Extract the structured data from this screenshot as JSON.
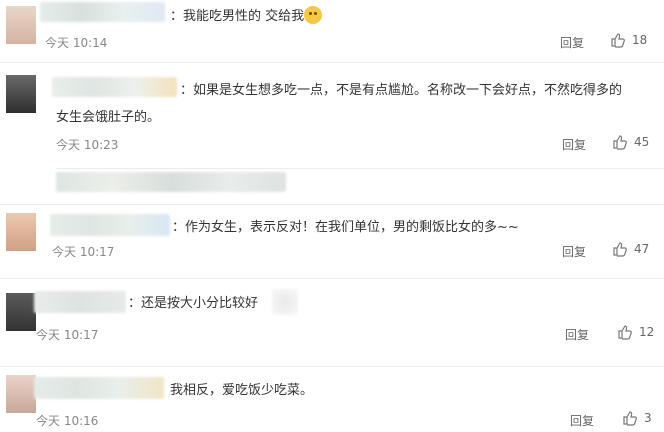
{
  "comments": [
    {
      "text": "：我能吃男性的 交给我",
      "emoji": "grin-face-icon",
      "time": "今天 10:14",
      "reply": "回复",
      "likes": "18"
    },
    {
      "text_line1": "：如果是女生想多吃一点，不是有点尴尬。名称改一下会好点，不然吃得多的",
      "text_line2": "女生会饿肚子的。",
      "time": "今天 10:23",
      "reply": "回复",
      "likes": "45"
    },
    {
      "text": "：作为女生，表示反对！在我们单位，男的剩饭比女的多~~",
      "time": "今天 10:17",
      "reply": "回复",
      "likes": "47"
    },
    {
      "text": "：还是按大小分比较好",
      "time": "今天 10:17",
      "reply": "回复",
      "likes": "12"
    },
    {
      "text": "我相反，爱吃饭少吃菜。",
      "time": "今天 10:16",
      "reply": "回复",
      "likes": "3"
    }
  ]
}
